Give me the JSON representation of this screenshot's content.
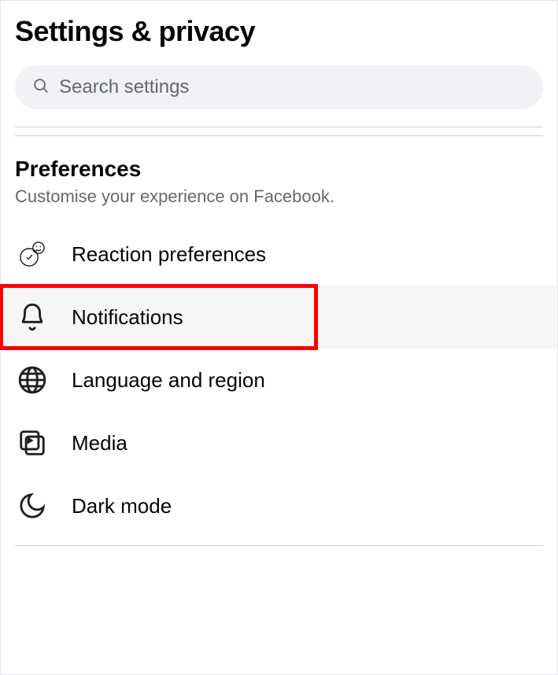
{
  "header": {
    "title": "Settings & privacy"
  },
  "search": {
    "placeholder": "Search settings"
  },
  "preferences": {
    "title": "Preferences",
    "subtitle": "Customise your experience on Facebook.",
    "items": [
      {
        "label": "Reaction preferences",
        "icon": "reaction"
      },
      {
        "label": "Notifications",
        "icon": "bell",
        "highlighted": true
      },
      {
        "label": "Language and region",
        "icon": "globe"
      },
      {
        "label": "Media",
        "icon": "media"
      },
      {
        "label": "Dark mode",
        "icon": "moon"
      }
    ]
  }
}
